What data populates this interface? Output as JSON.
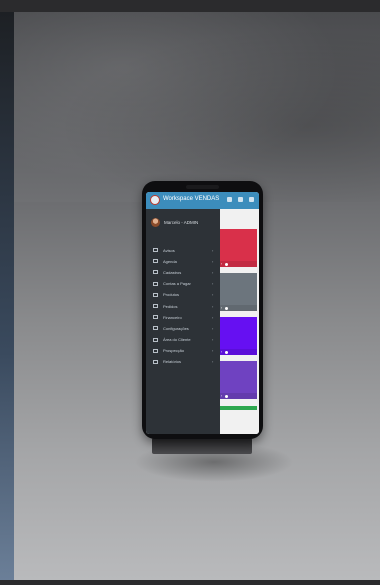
{
  "header": {
    "app_title": "Workspace VENDAS",
    "brand_color": "#3c8dbc"
  },
  "sidebar": {
    "user_name": "Marcelo - ADMIN",
    "items": [
      {
        "label": "Avisos",
        "icon": "table-icon"
      },
      {
        "label": "Agenda",
        "icon": "table-icon"
      },
      {
        "label": "Cadastros",
        "icon": "table-icon"
      },
      {
        "label": "Contas a Pagar",
        "icon": "table-icon"
      },
      {
        "label": "Produtos",
        "icon": "table-icon"
      },
      {
        "label": "Pedidos",
        "icon": "table-icon"
      },
      {
        "label": "Financeiro",
        "icon": "table-icon"
      },
      {
        "label": "Configurações",
        "icon": "table-icon"
      },
      {
        "label": "Área do Cliente",
        "icon": "table-icon"
      },
      {
        "label": "Prospecção",
        "icon": "table-icon"
      },
      {
        "label": "Relatórios",
        "icon": "table-icon"
      }
    ]
  },
  "cards": [
    {
      "color": "#d9304a"
    },
    {
      "color": "#6c757d"
    },
    {
      "color": "#6610f2"
    },
    {
      "color": "#6f42c1"
    }
  ],
  "accent_green": "#2ea84f"
}
